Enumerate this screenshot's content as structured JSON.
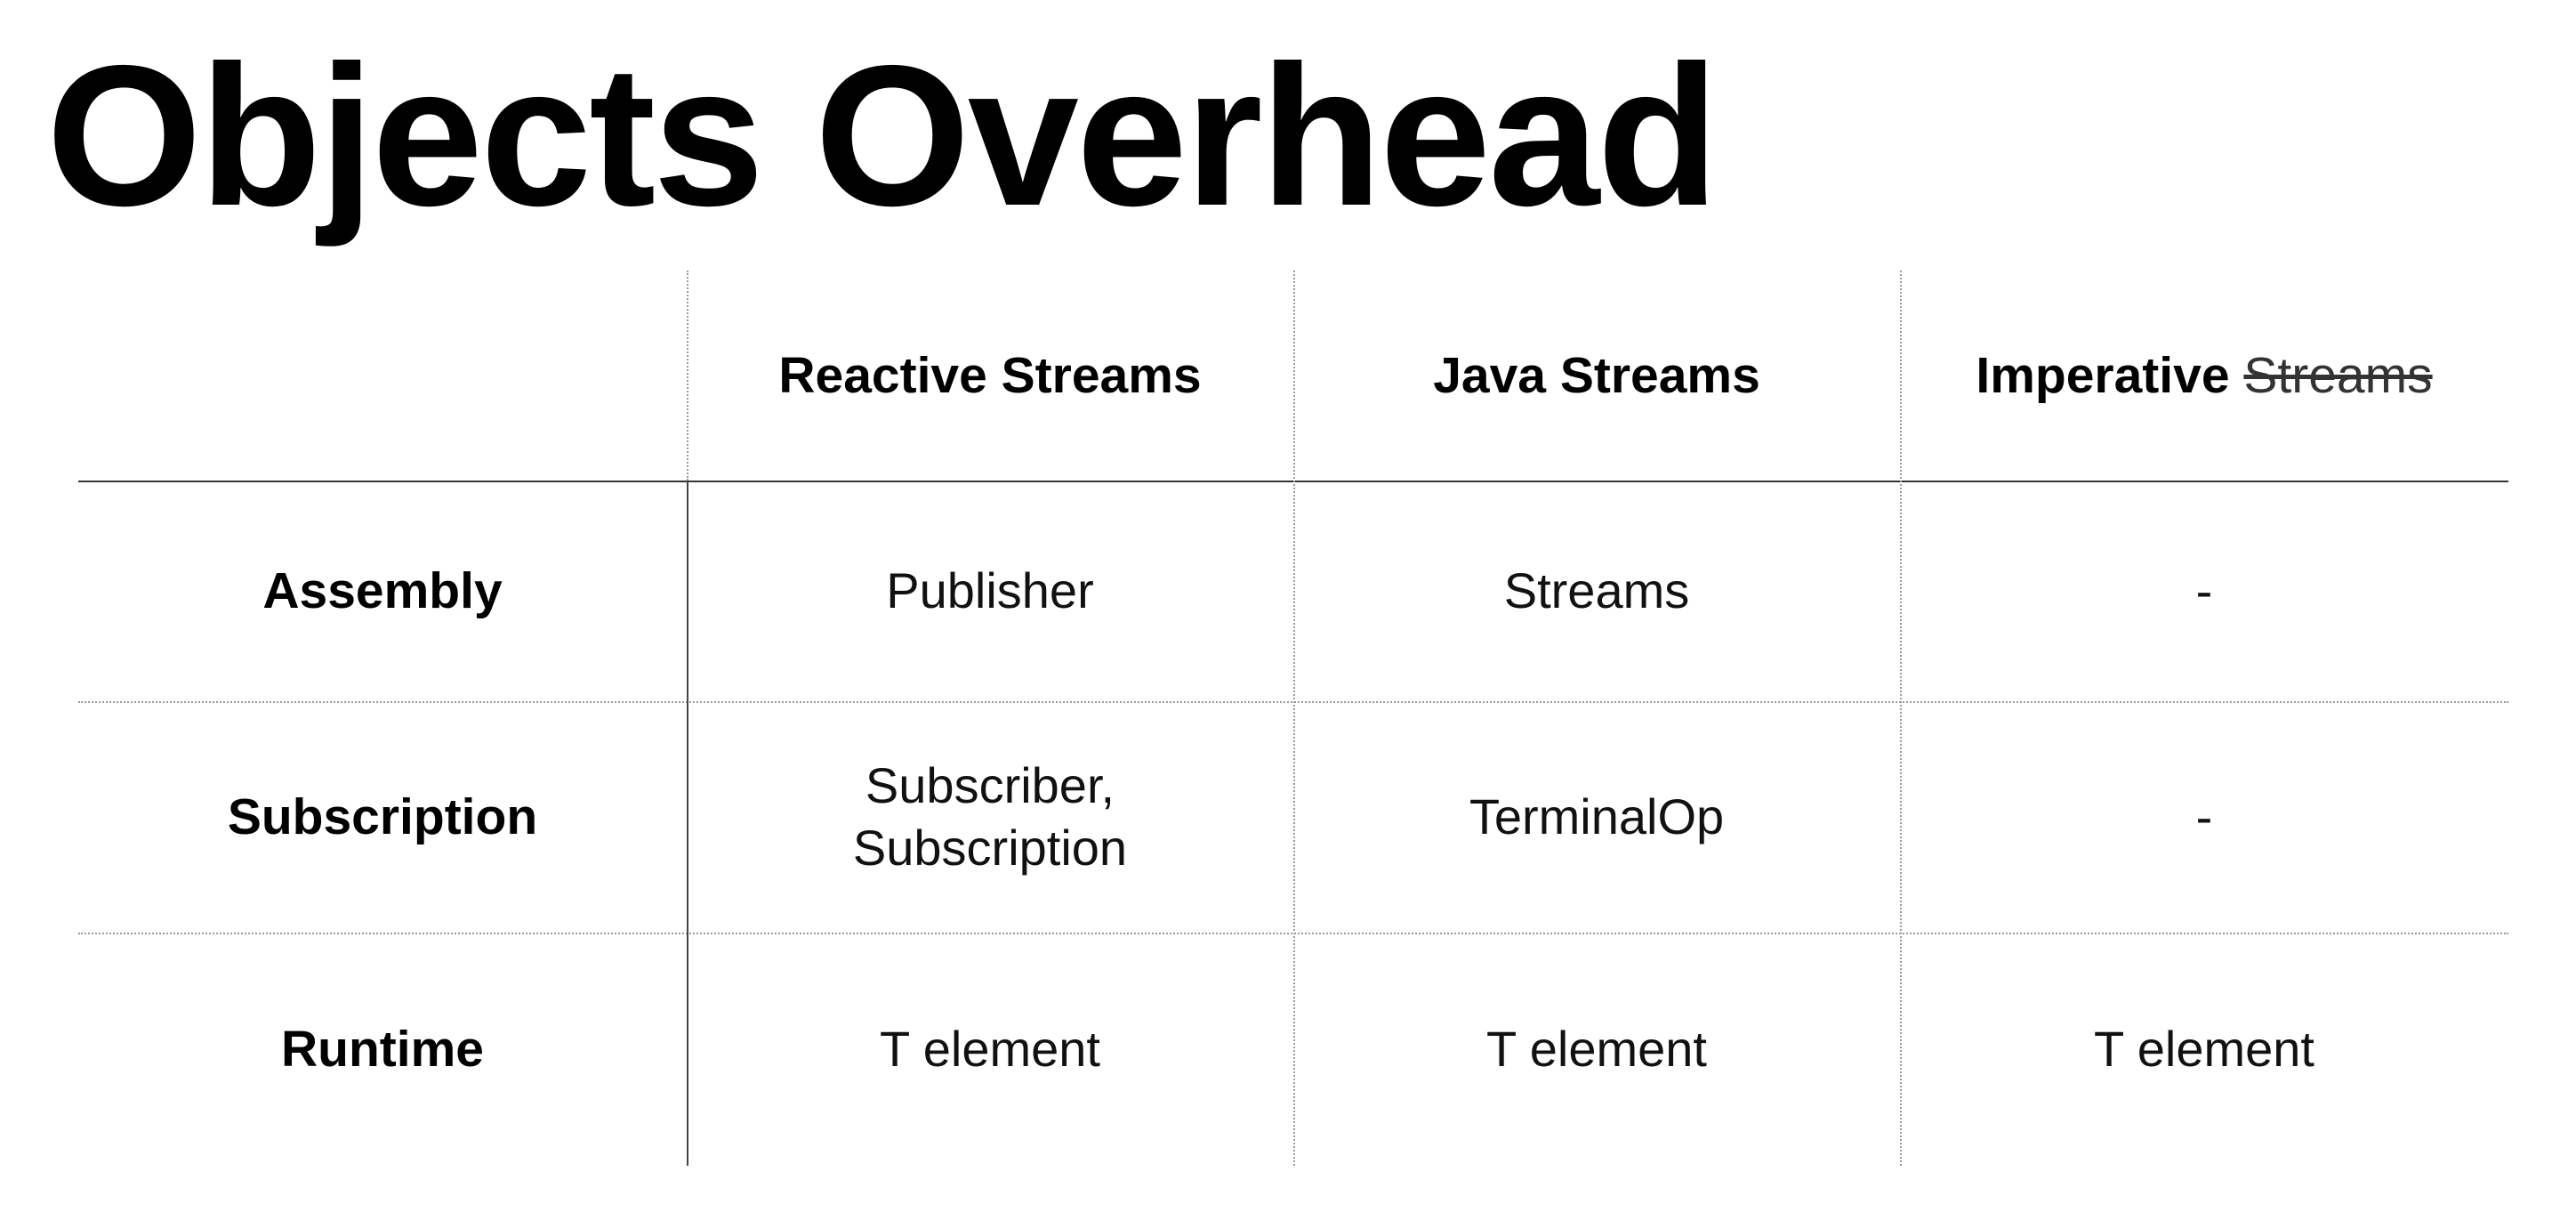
{
  "title": "Objects Overhead",
  "table": {
    "columns": [
      {
        "label": "Reactive Streams"
      },
      {
        "label": "Java Streams"
      },
      {
        "label": "Imperative",
        "struck": "Streams"
      }
    ],
    "rows": [
      {
        "label": "Assembly",
        "cells": [
          [
            "Publisher"
          ],
          [
            "Streams"
          ],
          [
            "-"
          ]
        ]
      },
      {
        "label": "Subscription",
        "cells": [
          [
            "Subscriber,",
            "Subscription"
          ],
          [
            "TerminalOp"
          ],
          [
            "-"
          ]
        ]
      },
      {
        "label": "Runtime",
        "cells": [
          [
            "T element"
          ],
          [
            "T element"
          ],
          [
            "T element"
          ]
        ]
      }
    ]
  }
}
